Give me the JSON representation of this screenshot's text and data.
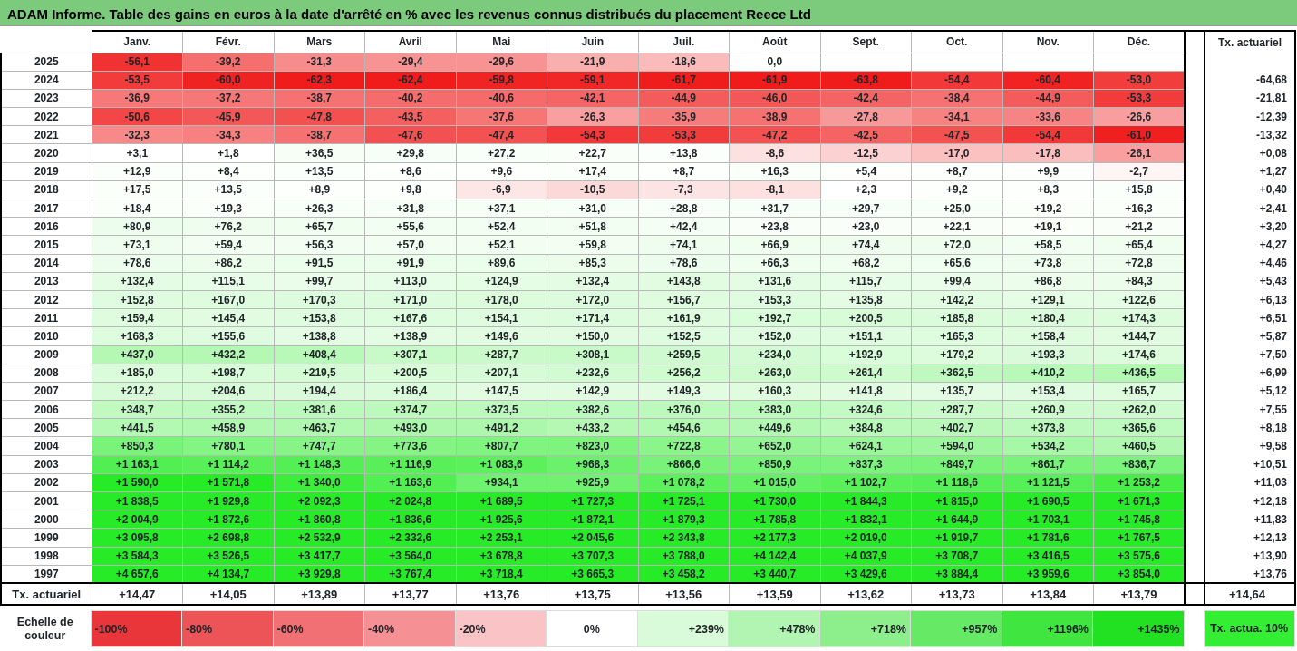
{
  "title": "ADAM Informe. Table des gains en euros à la date d'arrêté en % avec les revenus connus distribués du placement Reece Ltd",
  "columns": [
    "Janv.",
    "Févr.",
    "Mars",
    "Avril",
    "Mai",
    "Juin",
    "Juil.",
    "Août",
    "Sept.",
    "Oct.",
    "Nov.",
    "Déc."
  ],
  "rate_heading": "Tx. actuariel",
  "rows": [
    {
      "year": "2025",
      "cells": [
        "-56,1",
        "-39,2",
        "-31,3",
        "-29,4",
        "-29,6",
        "-21,9",
        "-18,6",
        "0,0"
      ]
    },
    {
      "year": "2024",
      "cells": [
        "-53,5",
        "-60,0",
        "-62,3",
        "-62,4",
        "-59,8",
        "-59,1",
        "-61,7",
        "-61,9",
        "-63,8",
        "-54,4",
        "-60,4",
        "-53,0"
      ],
      "rate": "-64,68"
    },
    {
      "year": "2023",
      "cells": [
        "-36,9",
        "-37,2",
        "-38,7",
        "-40,2",
        "-40,6",
        "-42,1",
        "-44,9",
        "-46,0",
        "-42,4",
        "-38,4",
        "-44,9",
        "-53,3"
      ],
      "rate": "-21,81"
    },
    {
      "year": "2022",
      "cells": [
        "-50,6",
        "-45,9",
        "-47,8",
        "-43,5",
        "-37,6",
        "-26,3",
        "-35,9",
        "-38,9",
        "-27,8",
        "-34,1",
        "-33,6",
        "-26,6"
      ],
      "rate": "-12,39"
    },
    {
      "year": "2021",
      "cells": [
        "-32,3",
        "-34,3",
        "-38,7",
        "-47,6",
        "-47,4",
        "-54,3",
        "-53,3",
        "-47,2",
        "-42,5",
        "-47,5",
        "-54,4",
        "-61,0"
      ],
      "rate": "-13,32"
    },
    {
      "year": "2020",
      "cells": [
        "+3,1",
        "+1,8",
        "+36,5",
        "+29,8",
        "+27,2",
        "+22,7",
        "+13,8",
        "-8,6",
        "-12,5",
        "-17,0",
        "-17,8",
        "-26,1"
      ],
      "rate": "+0,08"
    },
    {
      "year": "2019",
      "cells": [
        "+12,9",
        "+8,4",
        "+13,5",
        "+8,6",
        "+9,6",
        "+17,4",
        "+8,7",
        "+16,3",
        "+5,4",
        "+8,7",
        "+9,9",
        "-2,7"
      ],
      "rate": "+1,27"
    },
    {
      "year": "2018",
      "cells": [
        "+17,5",
        "+13,5",
        "+8,9",
        "+9,8",
        "-6,9",
        "-10,5",
        "-7,3",
        "-8,1",
        "+2,3",
        "+9,2",
        "+8,3",
        "+15,8"
      ],
      "rate": "+0,40"
    },
    {
      "year": "2017",
      "cells": [
        "+18,4",
        "+19,3",
        "+26,3",
        "+31,8",
        "+37,1",
        "+31,0",
        "+28,8",
        "+31,7",
        "+29,7",
        "+25,0",
        "+19,2",
        "+16,3"
      ],
      "rate": "+2,41"
    },
    {
      "year": "2016",
      "cells": [
        "+80,9",
        "+76,2",
        "+65,7",
        "+55,6",
        "+52,4",
        "+51,8",
        "+42,4",
        "+23,8",
        "+23,0",
        "+22,1",
        "+19,1",
        "+21,2"
      ],
      "rate": "+3,20"
    },
    {
      "year": "2015",
      "cells": [
        "+73,1",
        "+59,4",
        "+56,3",
        "+57,0",
        "+52,1",
        "+59,8",
        "+74,1",
        "+66,9",
        "+74,4",
        "+72,0",
        "+58,5",
        "+65,4"
      ],
      "rate": "+4,27"
    },
    {
      "year": "2014",
      "cells": [
        "+78,6",
        "+86,2",
        "+91,5",
        "+91,9",
        "+89,6",
        "+85,3",
        "+78,6",
        "+66,3",
        "+68,2",
        "+65,6",
        "+73,8",
        "+72,8"
      ],
      "rate": "+4,46"
    },
    {
      "year": "2013",
      "cells": [
        "+132,4",
        "+115,1",
        "+99,7",
        "+113,0",
        "+124,9",
        "+132,4",
        "+143,8",
        "+131,6",
        "+115,7",
        "+99,4",
        "+86,8",
        "+84,3"
      ],
      "rate": "+5,43"
    },
    {
      "year": "2012",
      "cells": [
        "+152,8",
        "+167,0",
        "+170,3",
        "+171,0",
        "+178,0",
        "+172,0",
        "+156,7",
        "+153,3",
        "+135,8",
        "+142,2",
        "+129,1",
        "+122,6"
      ],
      "rate": "+6,13"
    },
    {
      "year": "2011",
      "cells": [
        "+159,4",
        "+145,4",
        "+153,8",
        "+167,6",
        "+154,1",
        "+171,4",
        "+161,9",
        "+192,7",
        "+200,5",
        "+185,8",
        "+180,4",
        "+174,3"
      ],
      "rate": "+6,51"
    },
    {
      "year": "2010",
      "cells": [
        "+168,3",
        "+155,6",
        "+138,8",
        "+138,9",
        "+149,6",
        "+150,0",
        "+152,5",
        "+152,0",
        "+151,1",
        "+165,3",
        "+158,4",
        "+144,7"
      ],
      "rate": "+5,87"
    },
    {
      "year": "2009",
      "cells": [
        "+437,0",
        "+432,2",
        "+408,4",
        "+307,1",
        "+287,7",
        "+308,1",
        "+259,5",
        "+234,0",
        "+192,9",
        "+179,2",
        "+193,3",
        "+174,6"
      ],
      "rate": "+7,50"
    },
    {
      "year": "2008",
      "cells": [
        "+185,0",
        "+198,7",
        "+219,5",
        "+200,5",
        "+207,1",
        "+232,6",
        "+256,2",
        "+263,0",
        "+261,4",
        "+362,5",
        "+410,2",
        "+436,5"
      ],
      "rate": "+6,99"
    },
    {
      "year": "2007",
      "cells": [
        "+212,2",
        "+204,6",
        "+194,4",
        "+186,4",
        "+147,5",
        "+142,9",
        "+149,3",
        "+160,3",
        "+141,8",
        "+135,7",
        "+153,4",
        "+165,7"
      ],
      "rate": "+5,12"
    },
    {
      "year": "2006",
      "cells": [
        "+348,7",
        "+355,2",
        "+381,6",
        "+374,7",
        "+373,5",
        "+382,6",
        "+376,0",
        "+383,0",
        "+324,6",
        "+287,7",
        "+260,9",
        "+262,0"
      ],
      "rate": "+7,55"
    },
    {
      "year": "2005",
      "cells": [
        "+441,5",
        "+458,9",
        "+463,7",
        "+493,0",
        "+491,2",
        "+433,2",
        "+454,6",
        "+449,6",
        "+384,8",
        "+402,7",
        "+373,8",
        "+365,6"
      ],
      "rate": "+8,18"
    },
    {
      "year": "2004",
      "cells": [
        "+850,3",
        "+780,1",
        "+747,7",
        "+773,6",
        "+807,7",
        "+823,0",
        "+722,8",
        "+652,0",
        "+624,1",
        "+594,0",
        "+534,2",
        "+460,5"
      ],
      "rate": "+9,58"
    },
    {
      "year": "2003",
      "cells": [
        "+1 163,1",
        "+1 114,2",
        "+1 148,3",
        "+1 116,9",
        "+1 083,6",
        "+968,3",
        "+866,6",
        "+850,9",
        "+837,3",
        "+849,7",
        "+861,7",
        "+836,7"
      ],
      "rate": "+10,51"
    },
    {
      "year": "2002",
      "cells": [
        "+1 590,0",
        "+1 571,8",
        "+1 340,0",
        "+1 163,6",
        "+934,1",
        "+925,9",
        "+1 078,2",
        "+1 015,0",
        "+1 102,7",
        "+1 118,6",
        "+1 121,5",
        "+1 253,2"
      ],
      "rate": "+11,03"
    },
    {
      "year": "2001",
      "cells": [
        "+1 838,5",
        "+1 929,8",
        "+2 092,3",
        "+2 024,8",
        "+1 689,5",
        "+1 727,3",
        "+1 725,1",
        "+1 730,0",
        "+1 844,3",
        "+1 815,0",
        "+1 690,5",
        "+1 671,3"
      ],
      "rate": "+12,18"
    },
    {
      "year": "2000",
      "cells": [
        "+2 004,9",
        "+1 872,6",
        "+1 860,8",
        "+1 836,6",
        "+1 925,6",
        "+1 872,1",
        "+1 879,3",
        "+1 785,8",
        "+1 832,1",
        "+1 644,9",
        "+1 703,1",
        "+1 745,8"
      ],
      "rate": "+11,83"
    },
    {
      "year": "1999",
      "cells": [
        "+3 095,8",
        "+2 698,8",
        "+2 532,9",
        "+2 332,6",
        "+2 253,1",
        "+2 045,6",
        "+2 343,8",
        "+2 177,3",
        "+2 019,0",
        "+1 919,7",
        "+1 781,6",
        "+1 767,5"
      ],
      "rate": "+12,13"
    },
    {
      "year": "1998",
      "cells": [
        "+3 584,3",
        "+3 526,5",
        "+3 417,7",
        "+3 564,0",
        "+3 678,8",
        "+3 707,3",
        "+3 788,0",
        "+4 142,4",
        "+4 037,9",
        "+3 708,7",
        "+3 416,5",
        "+3 575,6"
      ],
      "rate": "+13,90"
    },
    {
      "year": "1997",
      "cells": [
        "+4 657,6",
        "+4 134,7",
        "+3 929,8",
        "+3 767,4",
        "+3 718,4",
        "+3 665,3",
        "+3 458,2",
        "+3 440,7",
        "+3 429,6",
        "+3 884,4",
        "+3 959,6",
        "+3 854,0"
      ],
      "rate": "+13,76"
    }
  ],
  "footer": {
    "label": "Tx. actuariel",
    "cells": [
      "+14,47",
      "+14,05",
      "+13,89",
      "+13,77",
      "+13,76",
      "+13,75",
      "+13,56",
      "+13,59",
      "+13,62",
      "+13,73",
      "+13,84",
      "+13,79"
    ],
    "rate": "+14,64"
  },
  "legend": {
    "label": "Echelle de couleur",
    "steps": [
      {
        "text": "-100%",
        "color": "#e8363a"
      },
      {
        "text": "-80%",
        "color": "#ed5458"
      },
      {
        "text": "-60%",
        "color": "#f07074"
      },
      {
        "text": "-40%",
        "color": "#f59094"
      },
      {
        "text": "-20%",
        "color": "#fac4c6"
      },
      {
        "text": "0%",
        "color": "#ffffff"
      },
      {
        "text": "+239%",
        "color": "#d9fbd9"
      },
      {
        "text": "+478%",
        "color": "#b2f5b2"
      },
      {
        "text": "+718%",
        "color": "#8cef8c"
      },
      {
        "text": "+957%",
        "color": "#66ea66"
      },
      {
        "text": "+1196%",
        "color": "#40e540"
      },
      {
        "text": "+1435%",
        "color": "#22e022"
      }
    ],
    "reference": {
      "text": "Tx. actua. 10%",
      "color": "#33ee33"
    }
  }
}
